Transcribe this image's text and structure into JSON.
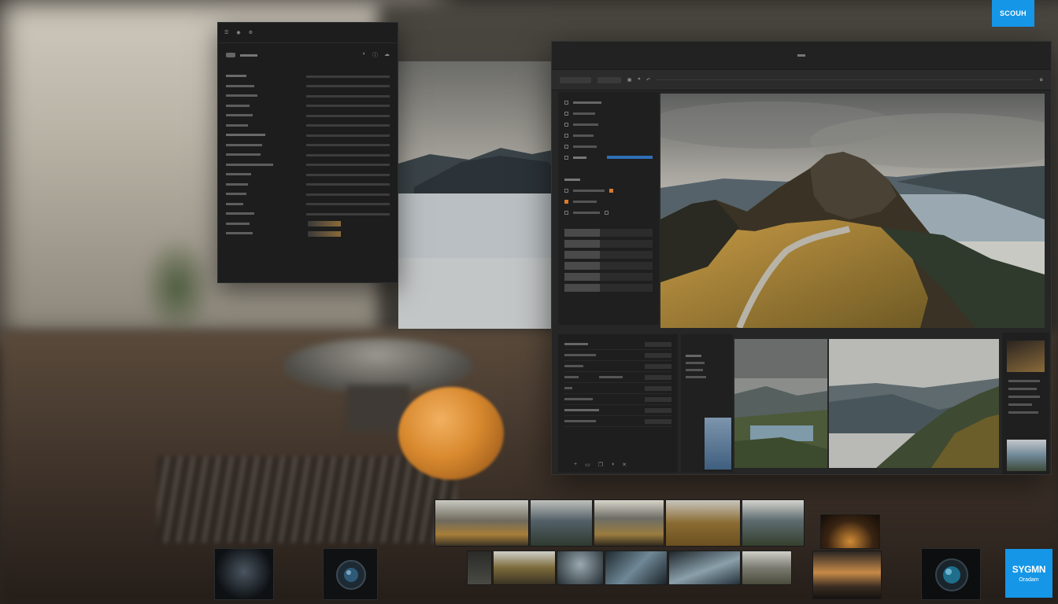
{
  "badges": {
    "top_label": "SCOUH",
    "bottom_title": "SYGMN",
    "bottom_subtitle": "Oradam"
  },
  "colors": {
    "accent_blue": "#1596e6",
    "panel_bg": "#1d1d1d",
    "editor_bg": "#262626",
    "highlight": "#2f6fb5",
    "orange_tag": "#d77a2e"
  },
  "icons": [
    "camera-icon",
    "settings-icon",
    "folder-icon",
    "grid-icon",
    "undo-icon",
    "crop-icon",
    "eye-icon"
  ]
}
